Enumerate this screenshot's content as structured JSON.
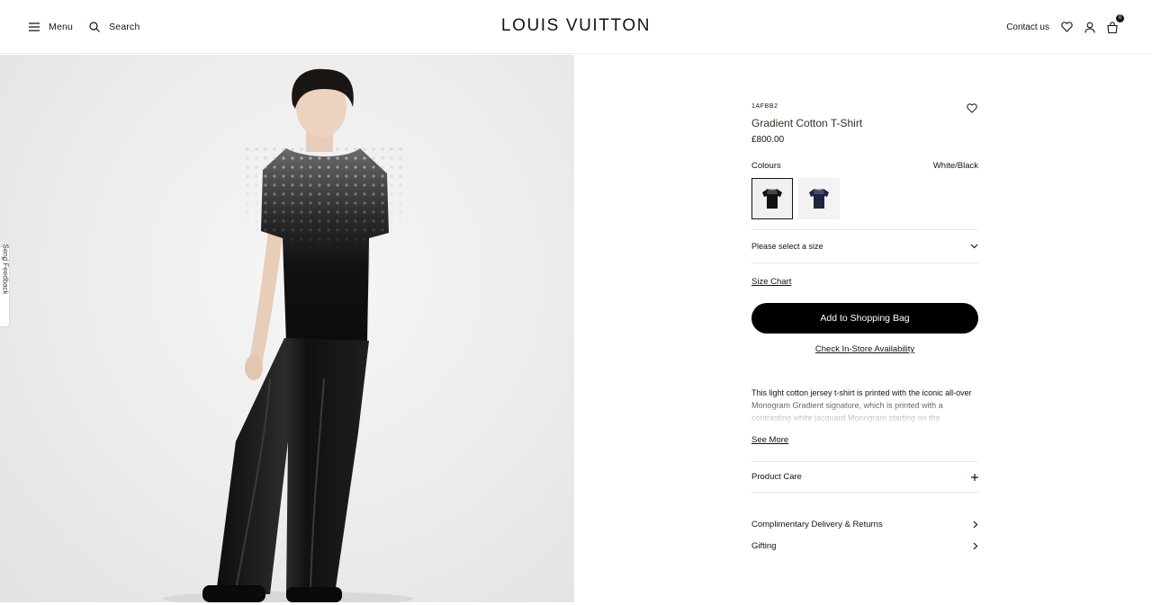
{
  "header": {
    "menu_label": "Menu",
    "search_label": "Search",
    "logo": "LOUIS VUITTON",
    "contact_label": "Contact us",
    "bag_count": "0"
  },
  "feedback": {
    "label": "Send Feedback",
    "close": "×"
  },
  "product": {
    "sku": "1AFBB2",
    "title": "Gradient Cotton T-Shirt",
    "price": "£800.00",
    "colours_label": "Colours",
    "colour_selected": "White/Black",
    "swatches": [
      {
        "name": "black",
        "color": "#111111",
        "selected": true
      },
      {
        "name": "navy",
        "color": "#1d2540",
        "selected": false
      }
    ],
    "size_placeholder": "Please select a size",
    "size_chart_label": "Size Chart",
    "add_to_bag_label": "Add to Shopping Bag",
    "store_availability_label": "Check In-Store Availability",
    "description": "This light cotton jersey t-shirt is printed with the iconic all-over Monogram Gradient signature, which is printed with a contrasting white jacquard Monogram starting on the",
    "see_more_label": "See More",
    "product_care_label": "Product Care",
    "delivery_label": "Complimentary Delivery & Returns",
    "gifting_label": "Gifting"
  }
}
